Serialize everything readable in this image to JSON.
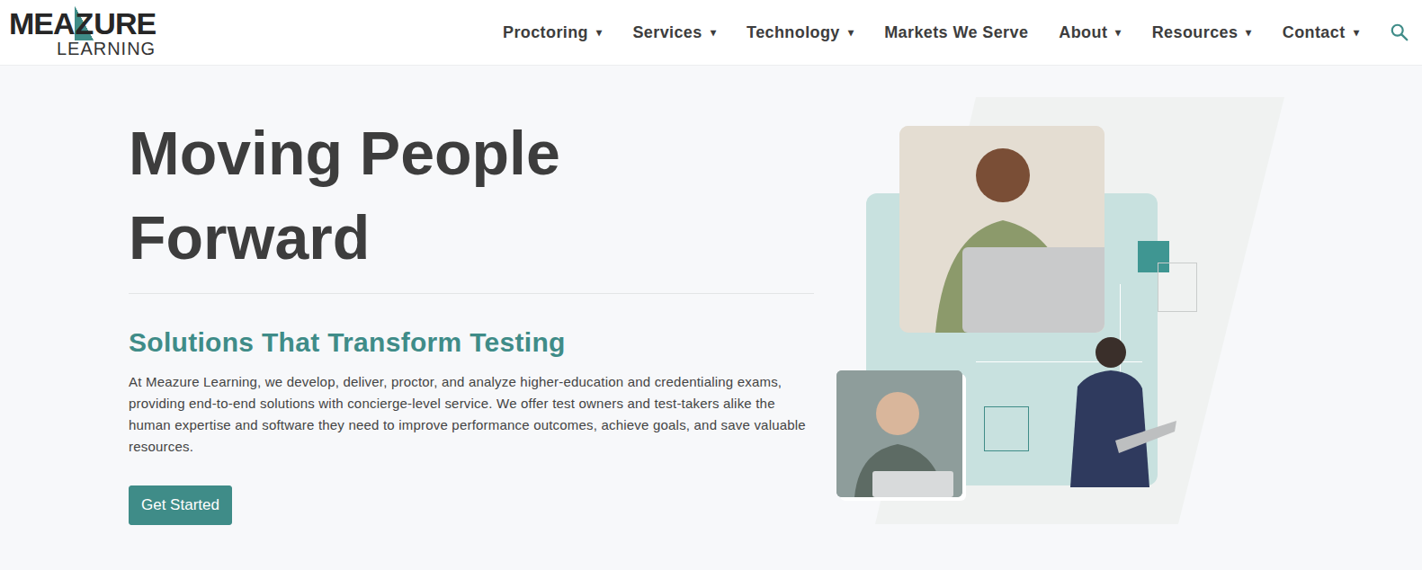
{
  "logo": {
    "name": "MEAZURE",
    "sub": "LEARNING"
  },
  "nav": {
    "items": [
      {
        "label": "Proctoring",
        "caret": "▾"
      },
      {
        "label": "Services",
        "caret": "▾"
      },
      {
        "label": "Technology",
        "caret": "▾"
      },
      {
        "label": "Markets We Serve"
      },
      {
        "label": "About",
        "caret": "▾"
      },
      {
        "label": "Resources",
        "caret": "▾"
      },
      {
        "label": "Contact",
        "caret": "▾"
      }
    ]
  },
  "hero": {
    "title": "Moving People Forward",
    "subtitle": "Solutions That Transform Testing",
    "body": "At Meazure Learning, we develop, deliver, proctor, and analyze higher-education and credentialing exams, providing end-to-end solutions with concierge-level service. We offer test owners and test-takers alike the human expertise and software they need to improve performance outcomes, achieve goals, and save valuable resources.",
    "button": "Get Started"
  }
}
